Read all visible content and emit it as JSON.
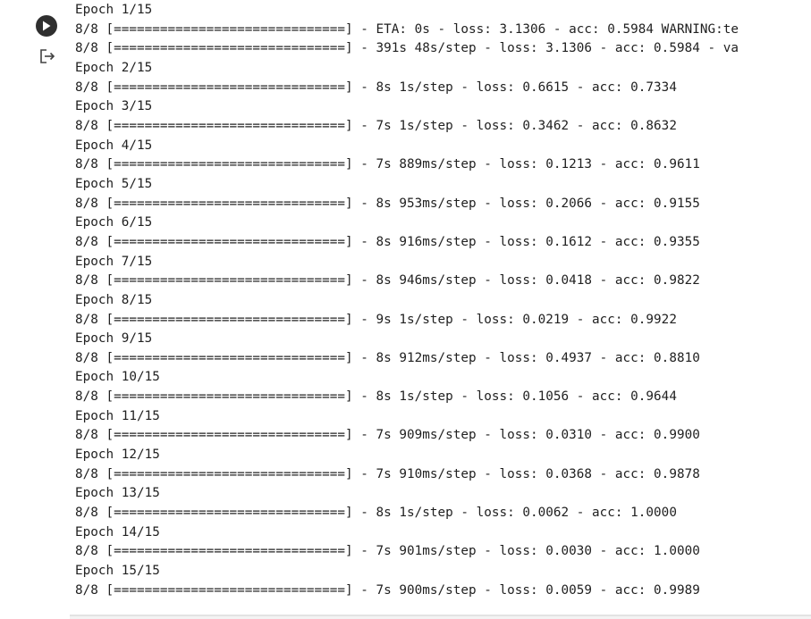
{
  "cell": {
    "run_icon": "play-circle-icon",
    "output_menu_icon": "output-exit-icon"
  },
  "output": {
    "lines": [
      "Epoch 1/15",
      "8/8 [==============================] - ETA: 0s - loss: 3.1306 - acc: 0.5984 WARNING:te",
      "8/8 [==============================] - 391s 48s/step - loss: 3.1306 - acc: 0.5984 - va",
      "Epoch 2/15",
      "8/8 [==============================] - 8s 1s/step - loss: 0.6615 - acc: 0.7334",
      "Epoch 3/15",
      "8/8 [==============================] - 7s 1s/step - loss: 0.3462 - acc: 0.8632",
      "Epoch 4/15",
      "8/8 [==============================] - 7s 889ms/step - loss: 0.1213 - acc: 0.9611",
      "Epoch 5/15",
      "8/8 [==============================] - 8s 953ms/step - loss: 0.2066 - acc: 0.9155",
      "Epoch 6/15",
      "8/8 [==============================] - 8s 916ms/step - loss: 0.1612 - acc: 0.9355",
      "Epoch 7/15",
      "8/8 [==============================] - 8s 946ms/step - loss: 0.0418 - acc: 0.9822",
      "Epoch 8/15",
      "8/8 [==============================] - 9s 1s/step - loss: 0.0219 - acc: 0.9922",
      "Epoch 9/15",
      "8/8 [==============================] - 8s 912ms/step - loss: 0.4937 - acc: 0.8810",
      "Epoch 10/15",
      "8/8 [==============================] - 8s 1s/step - loss: 0.1056 - acc: 0.9644",
      "Epoch 11/15",
      "8/8 [==============================] - 7s 909ms/step - loss: 0.0310 - acc: 0.9900",
      "Epoch 12/15",
      "8/8 [==============================] - 7s 910ms/step - loss: 0.0368 - acc: 0.9878",
      "Epoch 13/15",
      "8/8 [==============================] - 8s 1s/step - loss: 0.0062 - acc: 1.0000",
      "Epoch 14/15",
      "8/8 [==============================] - 7s 901ms/step - loss: 0.0030 - acc: 1.0000",
      "Epoch 15/15",
      "8/8 [==============================] - 7s 900ms/step - loss: 0.0059 - acc: 0.9989"
    ]
  }
}
